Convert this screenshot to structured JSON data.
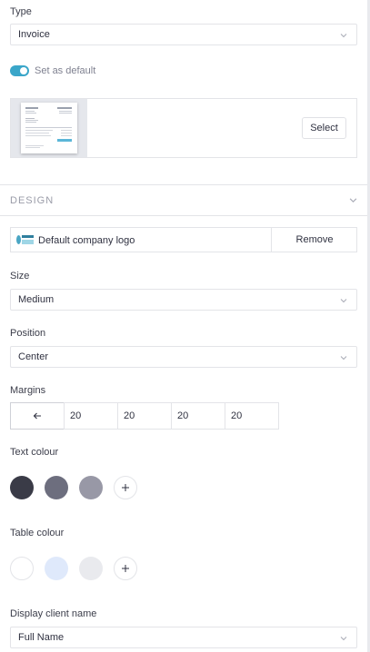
{
  "type": {
    "label": "Type",
    "value": "Invoice"
  },
  "default_toggle": {
    "label": "Set as default",
    "on": true,
    "color": "#3aa6c9"
  },
  "template": {
    "select_label": "Select"
  },
  "design": {
    "section_title": "DESIGN",
    "logo": {
      "name": "Default company logo",
      "remove_label": "Remove"
    },
    "size": {
      "label": "Size",
      "value": "Medium"
    },
    "position": {
      "label": "Position",
      "value": "Center"
    },
    "margins": {
      "label": "Margins",
      "values": [
        "20",
        "20",
        "20",
        "20"
      ]
    },
    "text_colour": {
      "label": "Text colour",
      "swatches": [
        "#3a3b47",
        "#6d6e7e",
        "#9898a6"
      ]
    },
    "table_colour": {
      "label": "Table colour",
      "swatches": [
        "#ffffff",
        "#dfe9fb",
        "#e9eaee"
      ]
    },
    "display_client_name": {
      "label": "Display client name",
      "value": "Full Name"
    }
  }
}
